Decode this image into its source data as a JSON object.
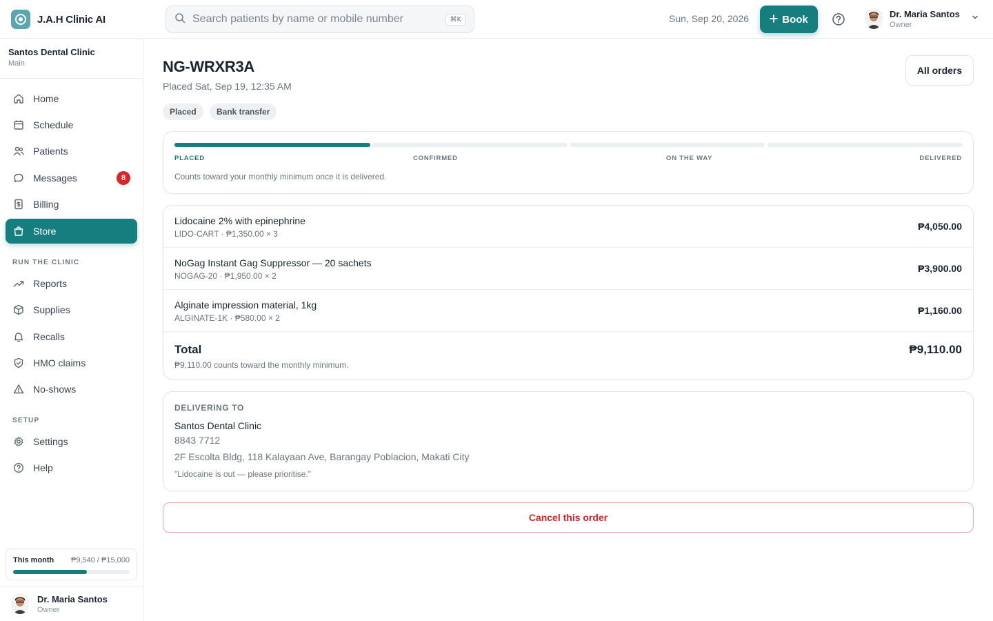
{
  "app": {
    "name": "J.A.H Clinic AI"
  },
  "search": {
    "placeholder": "Search patients by name or mobile number",
    "shortcut": "⌘K"
  },
  "header": {
    "date": "Sun, Sep 20, 2026",
    "book_label": "Book",
    "user": {
      "name": "Dr. Maria Santos",
      "role": "Owner"
    }
  },
  "clinic": {
    "name": "Santos Dental Clinic",
    "branch": "Main"
  },
  "sidebar": {
    "items": [
      {
        "label": "Home",
        "icon": "home-icon"
      },
      {
        "label": "Schedule",
        "icon": "calendar-icon"
      },
      {
        "label": "Patients",
        "icon": "users-icon"
      },
      {
        "label": "Messages",
        "icon": "message-icon",
        "badge": "8"
      },
      {
        "label": "Billing",
        "icon": "receipt-icon"
      },
      {
        "label": "Store",
        "icon": "shopping-bag-icon",
        "active": true
      }
    ],
    "section_run": "RUN THE CLINIC",
    "run_items": [
      {
        "label": "Reports",
        "icon": "trend-icon"
      },
      {
        "label": "Supplies",
        "icon": "box-icon"
      },
      {
        "label": "Recalls",
        "icon": "bell-icon"
      },
      {
        "label": "HMO claims",
        "icon": "shield-icon"
      },
      {
        "label": "No-shows",
        "icon": "warning-icon"
      }
    ],
    "section_setup": "SETUP",
    "setup_items": [
      {
        "label": "Settings",
        "icon": "gear-icon"
      },
      {
        "label": "Help",
        "icon": "help-icon"
      }
    ],
    "month": {
      "label": "This month",
      "value": "₱9,540 / ₱15,000",
      "progress": 0.636
    },
    "user": {
      "name": "Dr. Maria Santos",
      "role": "Owner"
    }
  },
  "order": {
    "id": "NG-WRXR3A",
    "placed_at": "Placed Sat, Sep 19, 12:35 AM",
    "all_orders_label": "All orders",
    "chips": [
      "Placed",
      "Bank transfer"
    ],
    "steps": [
      "PLACED",
      "CONFIRMED",
      "ON THE WAY",
      "DELIVERED"
    ],
    "current_step": 0,
    "progress_note": "Counts toward your monthly minimum once it is delivered.",
    "items": [
      {
        "name": "Lidocaine 2% with epinephrine",
        "meta": "LIDO-CART · ₱1,350.00 × 3",
        "amount": "₱4,050.00"
      },
      {
        "name": "NoGag Instant Gag Suppressor — 20 sachets",
        "meta": "NOGAG-20 · ₱1,950.00 × 2",
        "amount": "₱3,900.00"
      },
      {
        "name": "Alginate impression material, 1kg",
        "meta": "ALGINATE-1K · ₱580.00 × 2",
        "amount": "₱1,160.00"
      }
    ],
    "total_label": "Total",
    "total_amount": "₱9,110.00",
    "total_note": "₱9,110.00 counts toward the monthly minimum.",
    "delivery": {
      "label": "DELIVERING TO",
      "name": "Santos Dental Clinic",
      "phone": "8843 7712",
      "address": "2F Escolta Bldg, 118 Kalayaan Ave, Barangay Poblacion, Makati City",
      "note": "\"Lidocaine is out — please prioritise.\""
    },
    "cancel_label": "Cancel this order"
  },
  "colors": {
    "accent": "#177e80",
    "danger": "#d12626",
    "badge": "#dc2626"
  }
}
